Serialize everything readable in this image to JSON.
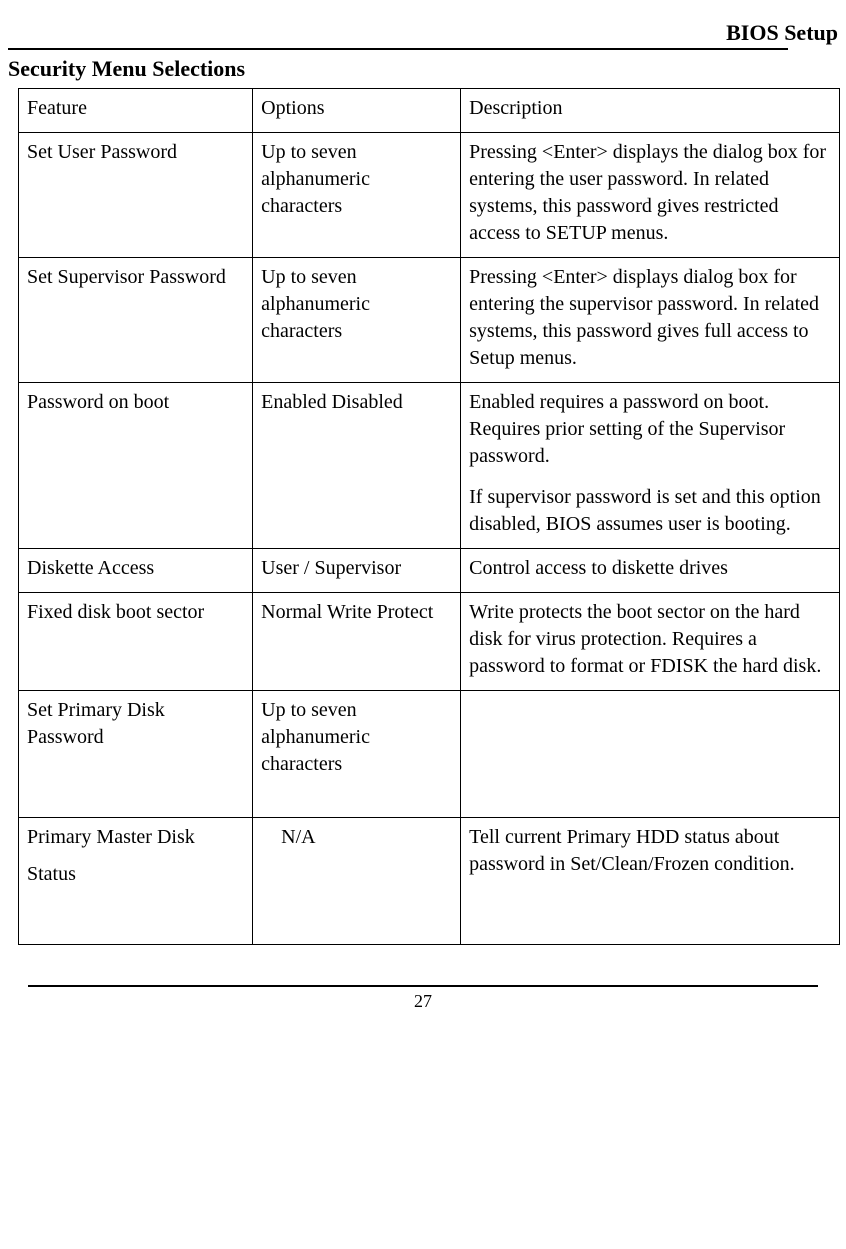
{
  "header": {
    "title": "BIOS Setup"
  },
  "section_title": "Security Menu Selections",
  "table": {
    "headers": {
      "feature": "Feature",
      "options": "Options",
      "description": "Description"
    },
    "rows": [
      {
        "feature": "Set User Password",
        "options": "Up to seven alphanumeric characters",
        "description": "Pressing <Enter> displays the dialog box for entering the user password. In related systems, this password gives restricted access to SETUP menus."
      },
      {
        "feature": "Set Supervisor Password",
        "options": "Up to seven alphanumeric characters",
        "description": "Pressing <Enter> displays dialog box for entering the supervisor password. In related systems, this password gives full access to Setup menus."
      },
      {
        "feature": "Password on boot",
        "options": "Enabled Disabled",
        "description": "Enabled requires a password on boot. Requires prior setting of the Supervisor password.",
        "description2": "If supervisor password is set and this option disabled, BIOS assumes user is booting."
      },
      {
        "feature": "Diskette Access",
        "options": "User / Supervisor",
        "description": "Control access to diskette drives"
      },
      {
        "feature": "Fixed disk boot sector",
        "options": "Normal Write Protect",
        "description": "Write protects the boot sector on the hard disk for virus protection. Requires a password to format or FDISK the hard disk."
      },
      {
        "feature": "Set Primary Disk Password",
        "options": "Up to seven alphanumeric characters",
        "description": ""
      },
      {
        "feature_line1": "Primary Master Disk",
        "feature_line2": "Status",
        "options": "N/A",
        "description": "Tell current Primary HDD status about password in Set/Clean/Frozen condition."
      }
    ]
  },
  "page_number": "27"
}
